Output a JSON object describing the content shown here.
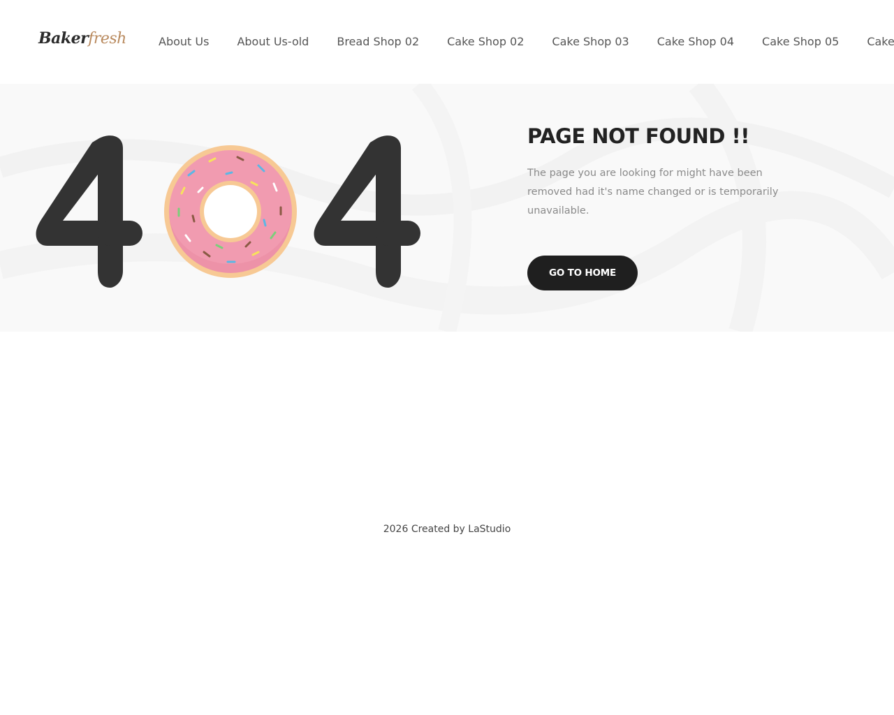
{
  "header": {
    "logo": {
      "part1": "Baker",
      "part2": "fresh"
    },
    "nav": [
      {
        "label": "About Us"
      },
      {
        "label": "About Us-old"
      },
      {
        "label": "Bread Shop 02"
      },
      {
        "label": "Cake Shop 02"
      },
      {
        "label": "Cake Shop 03"
      },
      {
        "label": "Cake Shop 04"
      },
      {
        "label": "Cake Shop 05"
      },
      {
        "label": "Cake"
      }
    ]
  },
  "hero": {
    "graphic_text": "404",
    "title": "PAGE NOT FOUND !!",
    "description": "The page you are looking for might have been removed had it's name changed or is temporarily unavailable.",
    "button_label": "GO TO HOME"
  },
  "footer": {
    "text": "2026 Created by LaStudio"
  },
  "colors": {
    "dark": "#333333",
    "button_bg": "#1f1f1f",
    "logo_accent": "#b98a5e",
    "donut_icing": "#f19bb0",
    "donut_dough": "#f6c48a"
  }
}
